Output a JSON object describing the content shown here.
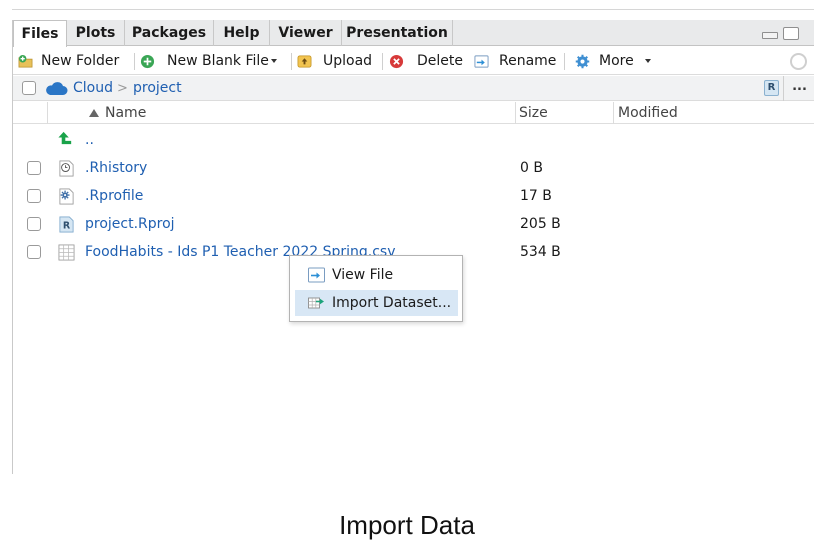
{
  "tabs": [
    {
      "label": "Files",
      "active": true
    },
    {
      "label": "Plots",
      "active": false
    },
    {
      "label": "Packages",
      "active": false
    },
    {
      "label": "Help",
      "active": false
    },
    {
      "label": "Viewer",
      "active": false
    },
    {
      "label": "Presentation",
      "active": false
    }
  ],
  "toolbar": {
    "new_folder": "New Folder",
    "new_blank_file": "New Blank File",
    "upload": "Upload",
    "delete": "Delete",
    "rename": "Rename",
    "more": "More",
    "overflow": "..."
  },
  "breadcrumb": {
    "root": "Cloud",
    "separator": ">",
    "current": "project"
  },
  "columns": {
    "name": "Name",
    "size": "Size",
    "modified": "Modified"
  },
  "files": {
    "parent": {
      "name": ".."
    },
    "items": [
      {
        "name": ".Rhistory",
        "size": "0 B",
        "icon": "history-file-icon"
      },
      {
        "name": ".Rprofile",
        "size": "17 B",
        "icon": "gear-file-icon"
      },
      {
        "name": "project.Rproj",
        "size": "205 B",
        "icon": "rproj-file-icon"
      },
      {
        "name": "FoodHabits - Ids P1 Teacher 2022 Spring.csv",
        "size": "534 B",
        "icon": "spreadsheet-file-icon"
      }
    ]
  },
  "context_menu": {
    "items": [
      {
        "label": "View File",
        "icon": "view-file-icon",
        "highlighted": false
      },
      {
        "label": "Import Dataset...",
        "icon": "import-dataset-icon",
        "highlighted": true
      }
    ]
  },
  "caption": "Import Data",
  "colors": {
    "link": "#1f5fb1",
    "highlight": "#d8e7f5",
    "up_arrow": "#1aa34a"
  }
}
